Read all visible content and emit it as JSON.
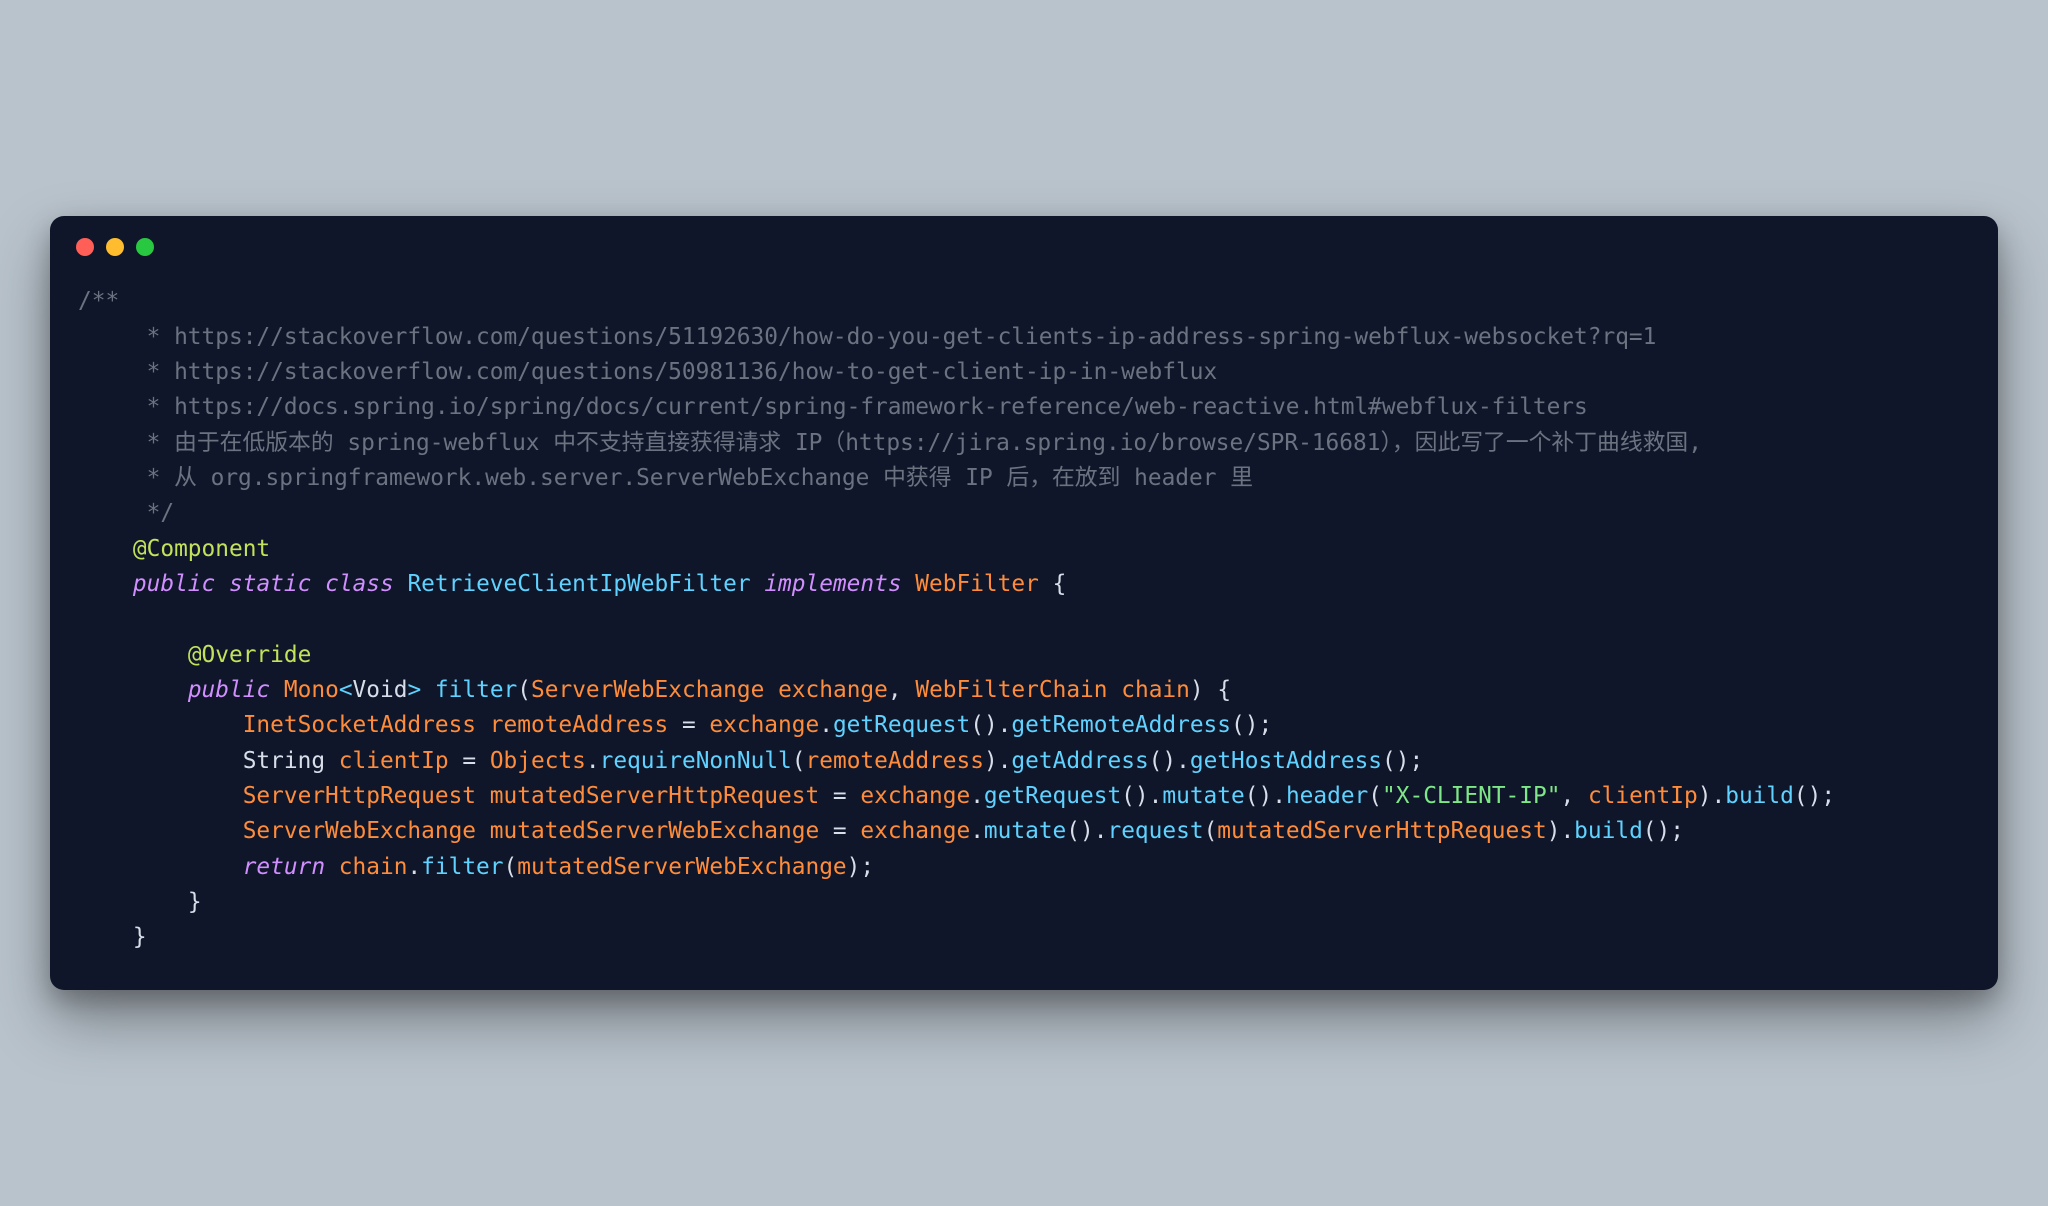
{
  "window": {
    "traffic_lights": [
      "red",
      "yellow",
      "green"
    ]
  },
  "colors": {
    "bg_page": "#b9c3cc",
    "bg_window": "#0f1629",
    "comment": "#6b7280",
    "annotation": "#c4e15a",
    "keyword": "#d18eff",
    "class_name": "#60d2ff",
    "interface_name": "#ff8c3a",
    "identifier": "#ff8c3a",
    "function": "#60d2ff",
    "string": "#7ee787",
    "default_text": "#d8dee9"
  },
  "code": {
    "comment_open": "/**",
    "comment_l1": "     * https://stackoverflow.com/questions/51192630/how-do-you-get-clients-ip-address-spring-webflux-websocket?rq=1",
    "comment_l2": "     * https://stackoverflow.com/questions/50981136/how-to-get-client-ip-in-webflux",
    "comment_l3": "     * https://docs.spring.io/spring/docs/current/spring-framework-reference/web-reactive.html#webflux-filters",
    "comment_l4": "     * 由于在低版本的 spring-webflux 中不支持直接获得请求 IP（https://jira.spring.io/browse/SPR-16681），因此写了一个补丁曲线救国,",
    "comment_l5": "     * 从 org.springframework.web.server.ServerWebExchange 中获得 IP 后，在放到 header 里",
    "comment_close": "     */",
    "ann_component": "@Component",
    "ann_override": "@Override",
    "kw_public": "public",
    "kw_static": "static",
    "kw_class": "class",
    "kw_implements": "implements",
    "kw_return": "return",
    "cls_RetrieveClientIpWebFilter": "RetrieveClientIpWebFilter",
    "iface_WebFilter": "WebFilter",
    "type_Mono": "Mono",
    "type_Void": "Void",
    "type_ServerWebExchange": "ServerWebExchange",
    "type_WebFilterChain": "WebFilterChain",
    "type_InetSocketAddress": "InetSocketAddress",
    "type_String": "String",
    "type_ServerHttpRequest": "ServerHttpRequest",
    "type_Objects": "Objects",
    "fn_filter": "filter",
    "fn_getRequest": "getRequest",
    "fn_getRemoteAddress": "getRemoteAddress",
    "fn_requireNonNull": "requireNonNull",
    "fn_getAddress": "getAddress",
    "fn_getHostAddress": "getHostAddress",
    "fn_mutate": "mutate",
    "fn_header": "header",
    "fn_build": "build",
    "fn_request": "request",
    "id_exchange": "exchange",
    "id_chain": "chain",
    "id_remoteAddress": "remoteAddress",
    "id_clientIp": "clientIp",
    "id_mutatedServerHttpRequest": "mutatedServerHttpRequest",
    "id_mutatedServerWebExchange": "mutatedServerWebExchange",
    "str_x_client_ip": "\"X-CLIENT-IP\"",
    "punct_lbrace": "{",
    "punct_rbrace": "}",
    "punct_lparen": "(",
    "punct_rparen": ")",
    "punct_lt": "<",
    "punct_gt": ">",
    "punct_comma": ",",
    "punct_dot": ".",
    "punct_semi": ";",
    "punct_eq": "="
  }
}
